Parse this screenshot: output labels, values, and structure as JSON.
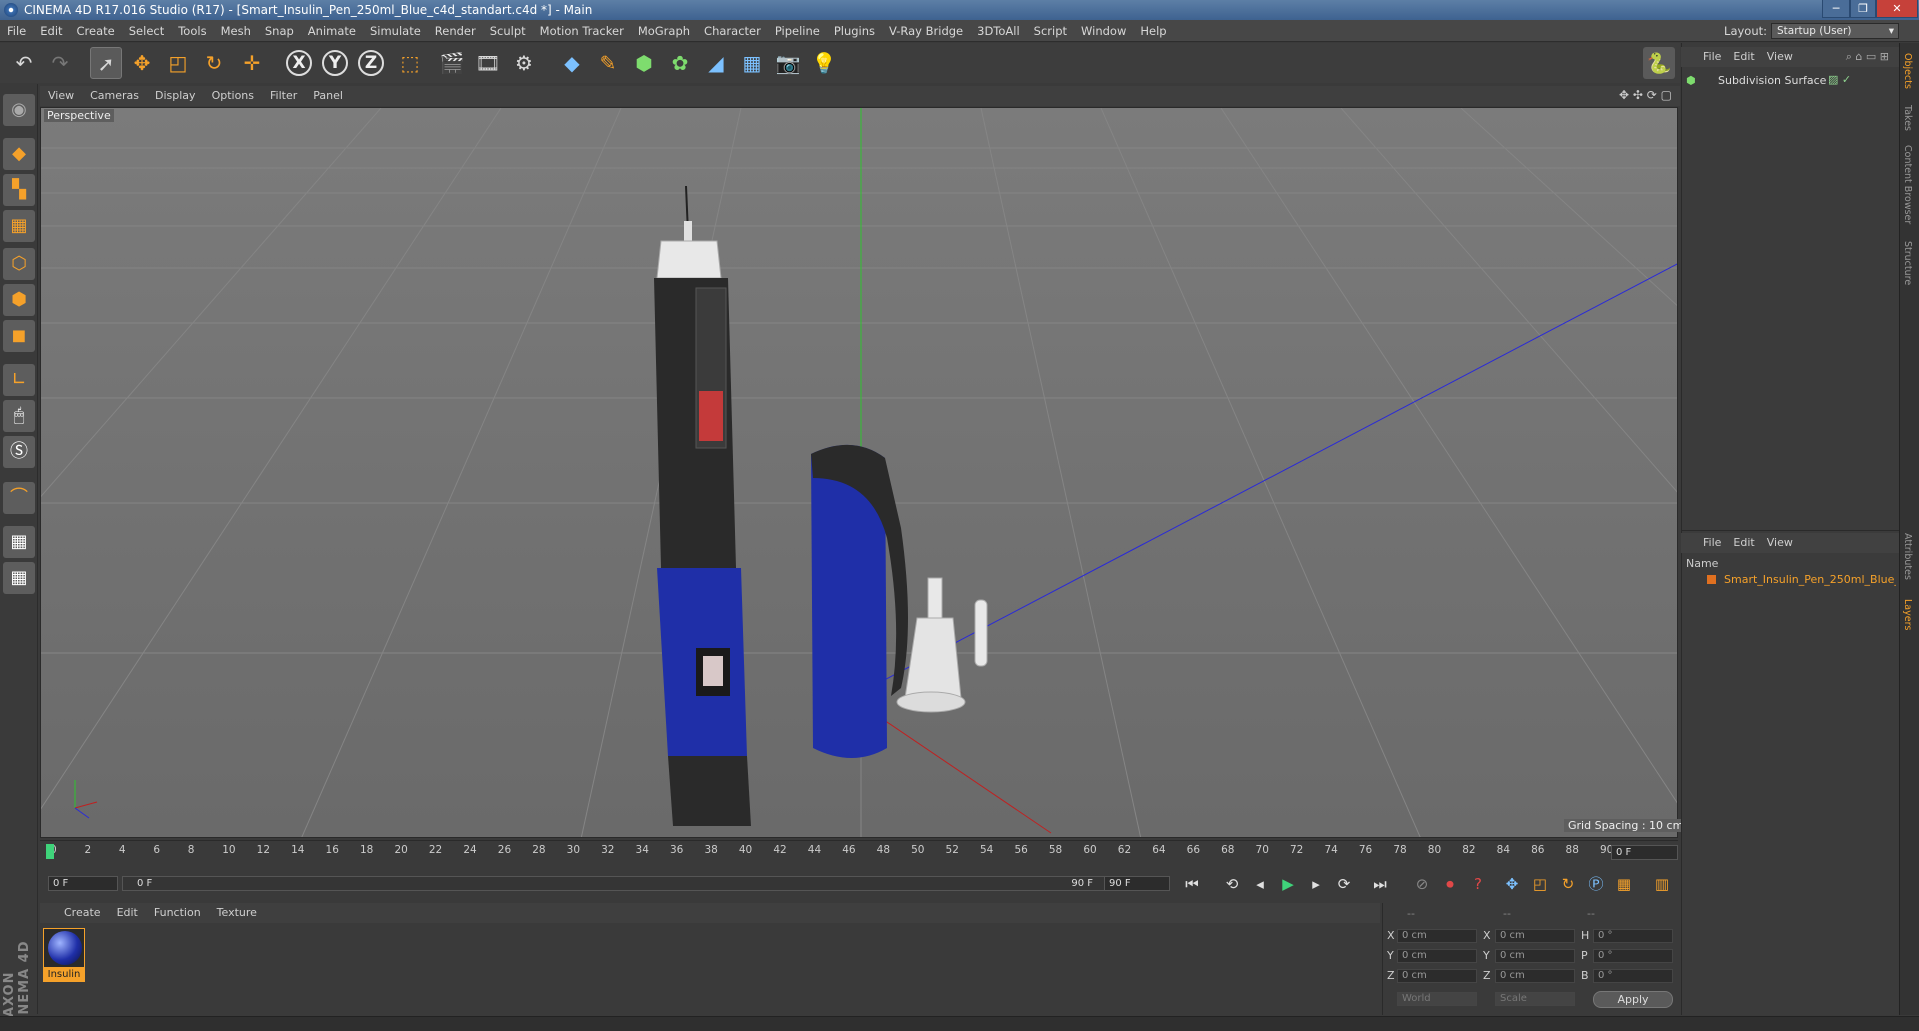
{
  "window": {
    "title": "CINEMA 4D R17.016 Studio (R17) - [Smart_Insulin_Pen_250ml_Blue_c4d_standart.c4d *] - Main",
    "minimize": "─",
    "restore": "❐",
    "close": "✕"
  },
  "menu": [
    "File",
    "Edit",
    "Create",
    "Select",
    "Tools",
    "Mesh",
    "Snap",
    "Animate",
    "Simulate",
    "Render",
    "Sculpt",
    "Motion Tracker",
    "MoGraph",
    "Character",
    "Pipeline",
    "Plugins",
    "V-Ray Bridge",
    "3DToAll",
    "Script",
    "Window",
    "Help"
  ],
  "layout": {
    "label": "Layout:",
    "value": "Startup (User)"
  },
  "axes": {
    "x": "X",
    "y": "Y",
    "z": "Z"
  },
  "viewport": {
    "menu": [
      "View",
      "Cameras",
      "Display",
      "Options",
      "Filter",
      "Panel"
    ],
    "label": "Perspective",
    "grid_spacing": "Grid Spacing : 10 cm"
  },
  "timeline": {
    "ticks": [
      "0",
      "2",
      "4",
      "6",
      "8",
      "10",
      "12",
      "14",
      "16",
      "18",
      "20",
      "22",
      "24",
      "26",
      "28",
      "30",
      "32",
      "34",
      "36",
      "38",
      "40",
      "42",
      "44",
      "46",
      "48",
      "50",
      "52",
      "54",
      "56",
      "58",
      "60",
      "62",
      "64",
      "66",
      "68",
      "70",
      "72",
      "74",
      "76",
      "78",
      "80",
      "82",
      "84",
      "86",
      "88",
      "90"
    ],
    "current_frame": "0 F",
    "range_start": "0 F",
    "slider_start": "0 F",
    "slider_end": "90 F",
    "range_end": "90 F",
    "playhead_fraction": 0
  },
  "material_panel": {
    "menu": [
      "Create",
      "Edit",
      "Function",
      "Texture"
    ],
    "material_name": "Insulin"
  },
  "coords": {
    "header": [
      "--",
      "--",
      "--"
    ],
    "rows": [
      {
        "l1": "X",
        "v1": "0 cm",
        "l2": "X",
        "v2": "0 cm",
        "l3": "H",
        "v3": "0 °"
      },
      {
        "l1": "Y",
        "v1": "0 cm",
        "l2": "Y",
        "v2": "0 cm",
        "l3": "P",
        "v3": "0 °"
      },
      {
        "l1": "Z",
        "v1": "0 cm",
        "l2": "Z",
        "v2": "0 cm",
        "l3": "B",
        "v3": "0 °"
      }
    ],
    "world": "World",
    "scale": "Scale",
    "apply": "Apply"
  },
  "objects_panel": {
    "menu": [
      "File",
      "Edit",
      "View"
    ],
    "item": "Subdivision Surface"
  },
  "layers_panel": {
    "menu": [
      "File",
      "Edit",
      "View"
    ],
    "column": "Name",
    "item": "Smart_Insulin_Pen_250ml_Blue_ma"
  },
  "right_tabs": [
    "Objects",
    "Takes",
    "Content Browser",
    "Structure",
    "Attributes",
    "Layers"
  ],
  "brand": "MAXON CINEMA 4D",
  "colors": {
    "accent": "#f5a12a",
    "layer_orange": "#e07020",
    "pen_blue": "#1f2fa8"
  }
}
